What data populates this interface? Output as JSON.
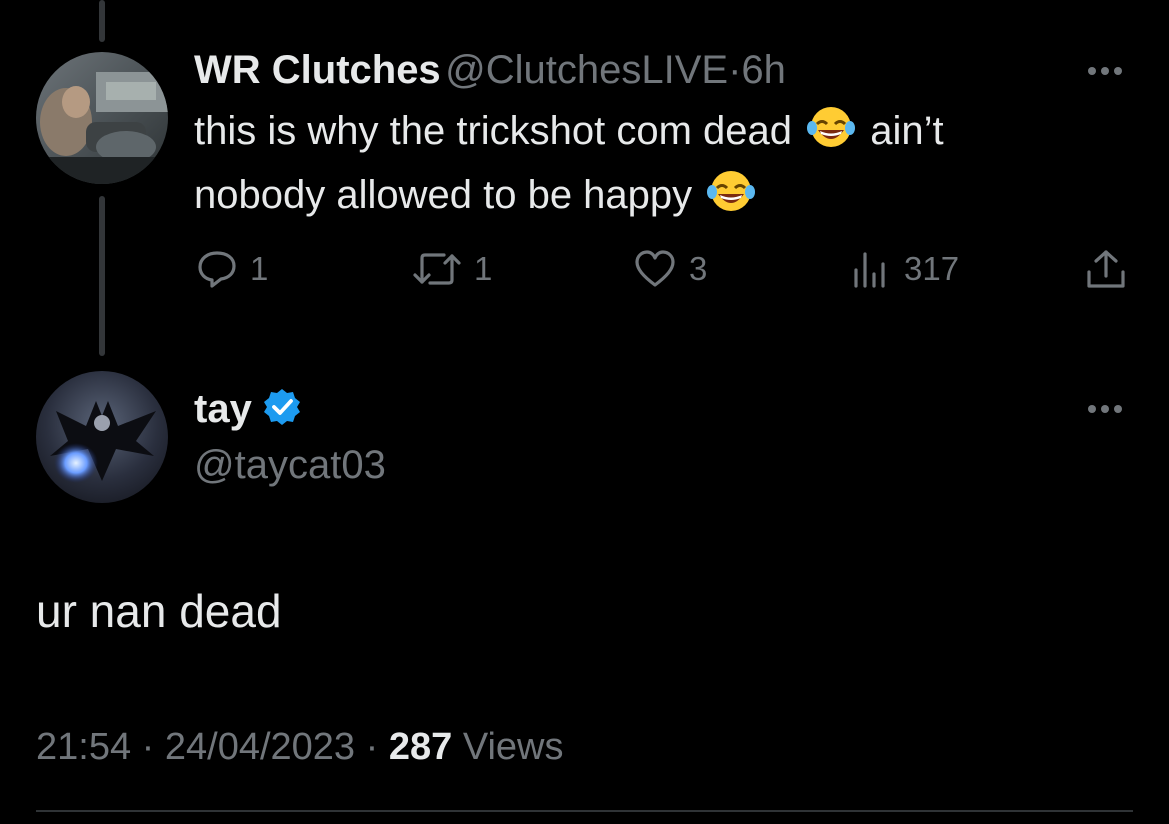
{
  "parent_tweet": {
    "display_name": "WR Clutches",
    "handle": "@ClutchesLIVE",
    "separator": "·",
    "time": "6h",
    "text_line1": "this is why the trickshot com dead",
    "text_line1_after": "ain’t",
    "text_line2": "nobody allowed to be happy",
    "emoji": "face-with-tears-of-joy",
    "actions": {
      "replies": "1",
      "reposts": "1",
      "likes": "3",
      "views": "317"
    }
  },
  "reply_tweet": {
    "display_name": "tay",
    "handle": "@taycat03",
    "verified": true,
    "text": "ur nan dead",
    "timestamp": "21:54",
    "separator": "·",
    "date": "24/04/2023",
    "views_count": "287",
    "views_label": "Views"
  },
  "colors": {
    "background": "#000000",
    "primary_text": "#e7e9ea",
    "secondary_text": "#71767b",
    "verified_blue": "#1d9bf0",
    "thread_line": "#333639"
  }
}
